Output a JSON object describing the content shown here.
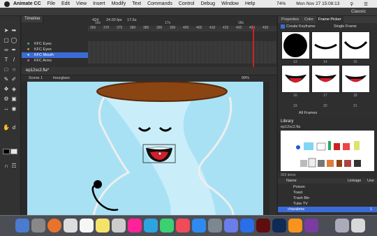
{
  "menubar": {
    "app": "Animate CC",
    "items": [
      "File",
      "Edit",
      "View",
      "Insert",
      "Modify",
      "Text",
      "Commands",
      "Control",
      "Debug",
      "Window",
      "Help"
    ],
    "battery": "74%",
    "datetime": "Mon Nov 27  15:08:13"
  },
  "appbar": {
    "workspace": "Classic"
  },
  "timeline": {
    "title": "Timeline",
    "frame": "424",
    "fps": "24.00 fps",
    "time": "17.6s",
    "layers": [
      {
        "name": "KFC Eyes"
      },
      {
        "name": "KFC Eyes"
      },
      {
        "name": "KFC Mouth"
      },
      {
        "name": "KFC Arms"
      }
    ],
    "ruler": [
      "365",
      "370",
      "375",
      "380",
      "385",
      "390",
      "395",
      "400",
      "405",
      "410",
      "415",
      "420",
      "425",
      "430"
    ],
    "ruler_top": [
      "16s",
      "17s",
      "18s"
    ]
  },
  "stage": {
    "tab": "ep12sc2.fla*",
    "breadcrumb": [
      "Scene 1",
      "hourglass"
    ],
    "zoom": "99%"
  },
  "rightpanel": {
    "tabs": [
      "Properties",
      "Color",
      "Frame Picker"
    ],
    "create_keyframe": "Create Keyframe",
    "mode": "Single Frame",
    "row1_nums": [
      "13",
      "14",
      "15"
    ],
    "row2_nums": [
      "16",
      "17",
      "18"
    ],
    "row3_nums": [
      "19",
      "20",
      "21"
    ],
    "filter": "All Frames"
  },
  "library": {
    "title": "Library",
    "file": "ep12sc2.fla",
    "count": "933 items",
    "columns": [
      "Name",
      "Linkage",
      "Use"
    ],
    "items": [
      {
        "name": "Poison",
        "use": ""
      },
      {
        "name": "Toast",
        "use": ""
      },
      {
        "name": "Trash Bin",
        "use": ""
      },
      {
        "name": "Tube TV",
        "use": ""
      },
      {
        "name": "charabms",
        "use": "1"
      }
    ]
  },
  "colors": {
    "accent": "#3b6bd6",
    "stage": "#a8e1f4",
    "playhead": "#c22222"
  }
}
